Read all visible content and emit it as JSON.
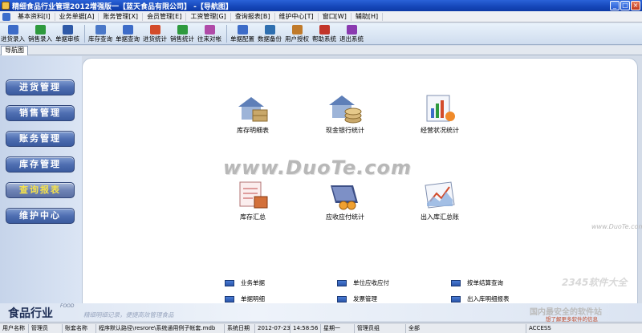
{
  "window": {
    "title": "精细食品行业管理2012增强版一【蓝天食品有限公司】 -【导航图】",
    "controls": [
      "_",
      "□",
      "×"
    ]
  },
  "menubar": {
    "items": [
      "基本资料[I]",
      "业务单据[A]",
      "账务管理[X]",
      "会员管理[E]",
      "工资管理[G]",
      "查询报表[B]",
      "维护中心[T]",
      "窗口[W]",
      "辅助[H]"
    ]
  },
  "toolbar": {
    "group1": [
      {
        "label": "进货录入",
        "icon": "import-entry-icon",
        "color": "#3d6cc8"
      },
      {
        "label": "销售录入",
        "icon": "sales-entry-icon",
        "color": "#2e9a3e"
      },
      {
        "label": "单据审核",
        "icon": "doc-audit-icon",
        "color": "#2f5aa8"
      }
    ],
    "group2": [
      {
        "label": "库存查询",
        "icon": "stock-query-icon",
        "color": "#4a78c8"
      },
      {
        "label": "单据查询",
        "icon": "doc-query-icon",
        "color": "#3d6cc8"
      },
      {
        "label": "进货统计",
        "icon": "purchase-stats-icon",
        "color": "#d34b2a"
      },
      {
        "label": "销售统计",
        "icon": "sales-stats-icon",
        "color": "#2e9a3e"
      },
      {
        "label": "往来对帐",
        "icon": "reconcile-icon",
        "color": "#b04aa8"
      }
    ],
    "group3": [
      {
        "label": "单据配置",
        "icon": "doc-config-icon",
        "color": "#3d6cc8"
      },
      {
        "label": "数据备份",
        "icon": "backup-icon",
        "color": "#2e6fb0"
      },
      {
        "label": "用户授权",
        "icon": "user-auth-icon",
        "color": "#c07a2a"
      },
      {
        "label": "帮助系统",
        "icon": "help-icon",
        "color": "#c2352a"
      },
      {
        "label": "退出系统",
        "icon": "exit-icon",
        "color": "#8a3ab0"
      }
    ]
  },
  "navtab": {
    "label": "导航图"
  },
  "sidebar": {
    "items": [
      {
        "label": "进货管理",
        "active": false
      },
      {
        "label": "销售管理",
        "active": false
      },
      {
        "label": "账务管理",
        "active": false
      },
      {
        "label": "库存管理",
        "active": false
      },
      {
        "label": "查询报表",
        "active": true
      },
      {
        "label": "维护中心",
        "active": false
      }
    ]
  },
  "tiles": {
    "row1": [
      {
        "label": "库存明细表",
        "icon": "stock-detail-icon"
      },
      {
        "label": "现金银行统计",
        "icon": "cash-bank-icon"
      },
      {
        "label": "经营状况统计",
        "icon": "business-status-icon"
      }
    ],
    "row2": [
      {
        "label": "库存汇总",
        "icon": "stock-summary-icon"
      },
      {
        "label": "应收应付统计",
        "icon": "receivable-payable-icon"
      },
      {
        "label": "出入库汇总账",
        "icon": "inout-summary-icon"
      }
    ]
  },
  "watermark": {
    "main": "www.DuoTe.com",
    "small": "www.DuoTe.com"
  },
  "quicklinks": [
    {
      "label": "业务单据"
    },
    {
      "label": "单位应收应付"
    },
    {
      "label": "按单结算查询"
    },
    {
      "label": "单据明细"
    },
    {
      "label": "发票管理"
    },
    {
      "label": "出入库明细报表"
    }
  ],
  "brand": {
    "logo": "食品行业",
    "logo_sub": "FOOD",
    "slogan": "精细明细记录，便捷高效管理食品",
    "right_wm": "国内最安全的软件站",
    "right_wm2": "想了解更多软件的信息",
    "top_wm": "2345软件大全"
  },
  "statusbar": {
    "cells": [
      "用户名称",
      "管理员",
      "账套名称",
      "程序默认路径\\resrore\\系统通用例子帐套.mdb",
      "系统日期",
      "2012-07-23",
      "14:58:56",
      "星期一",
      "管理员组",
      "全部",
      "ACCESS"
    ]
  },
  "colors": {
    "title_bar": "#1546b8",
    "nav_button": "#4f6fb2",
    "active_text": "#f7e34a"
  }
}
